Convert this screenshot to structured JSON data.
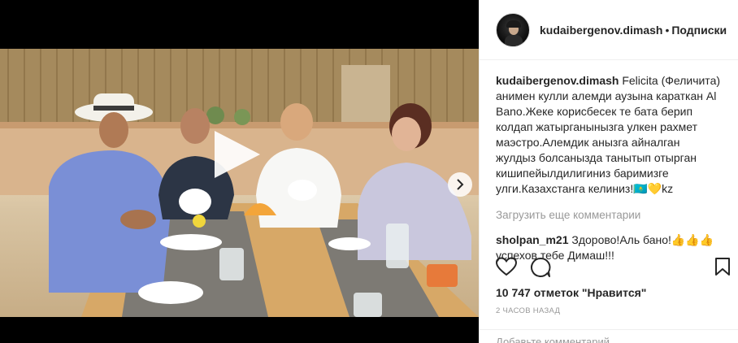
{
  "post": {
    "username": "kudaibergenov.dimash",
    "separator": "•",
    "follow_label": "Подписки",
    "caption_user": "kudaibergenov.dimash",
    "caption_text": "Felicita (Феличита) анимен кулли алемди аузына караткан Al Bano.Жеке корисбесек те бата берип колдап жатырганынызга улкен рахмет маэстро.Алемдик анызга айналган жулдыз болсаныздa танытып отырган кишипейылдилигиниз баримизге улги.Казахстанга келиниз!🇰🇿💛kz",
    "load_more_label": "Загрузить еще комментарии",
    "comments": [
      {
        "user": "sholpan_m21",
        "text": "Здорово!Аль бано!👍👍👍 успехов тебе Димаш!!!"
      }
    ],
    "likes_text": "10 747 отметок \"Нравится\"",
    "time_text": "2 ЧАСОВ НАЗАД",
    "add_comment_placeholder": "Добавьте комментарий..."
  },
  "icons": {
    "like": "heart-icon",
    "comment": "comment-icon",
    "save": "bookmark-icon",
    "play": "play-icon",
    "next": "chevron-right-icon"
  },
  "colors": {
    "text": "#262626",
    "muted": "#999999",
    "border": "#efefef"
  }
}
